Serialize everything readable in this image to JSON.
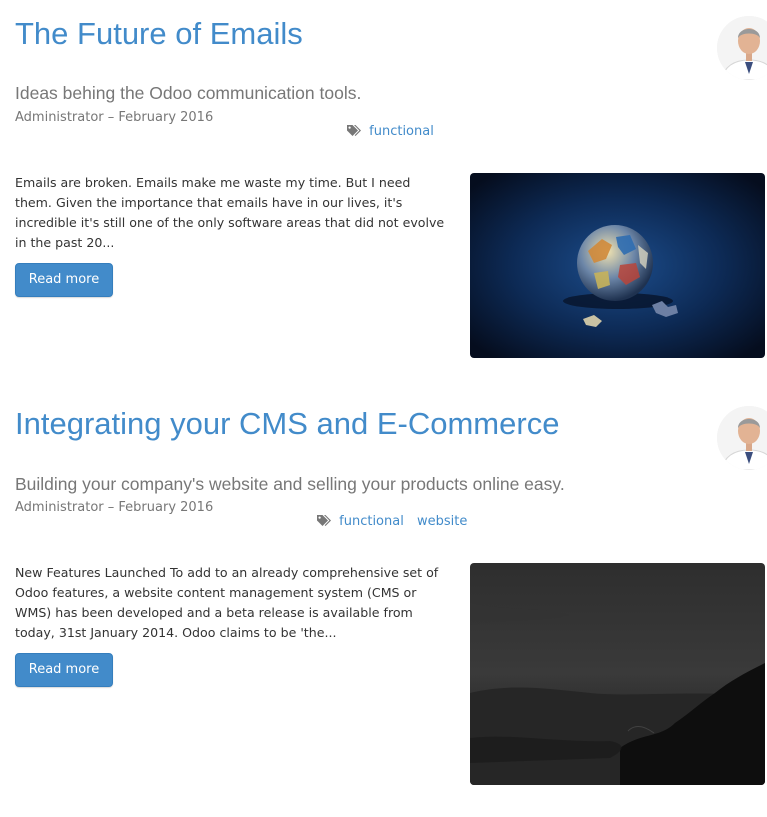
{
  "posts": [
    {
      "title": "The Future of Emails",
      "subtitle": "Ideas behing the Odoo communication tools.",
      "author": "Administrator",
      "separator": "–",
      "date": "February 2016",
      "tags": [
        "functional"
      ],
      "excerpt": "Emails are broken. Emails make me waste my time. But I need them. Given the importance that emails have in our lives, it's incredible it's still one of the only software areas that did not evolve in the past 20...",
      "read_more_label": "Read more",
      "image": "globe-puzzle-image"
    },
    {
      "title": "Integrating your CMS and E-Commerce",
      "subtitle": "Building your company's website and selling your products online easy.",
      "author": "Administrator",
      "separator": "–",
      "date": "February 2016",
      "tags": [
        "functional",
        "website"
      ],
      "excerpt": "New Features Launched To add to an already comprehensive set of Odoo features, a website content management system (CMS or WMS) has been developed and a beta release is available from today, 31st January 2014. Odoo claims to be 'the...",
      "read_more_label": "Read more",
      "image": "dark-coast-image"
    }
  ],
  "icons": {
    "tag": "tags-icon",
    "avatar": "author-avatar"
  },
  "colors": {
    "link": "#428bca",
    "muted": "#777777",
    "button": "#428bca"
  }
}
